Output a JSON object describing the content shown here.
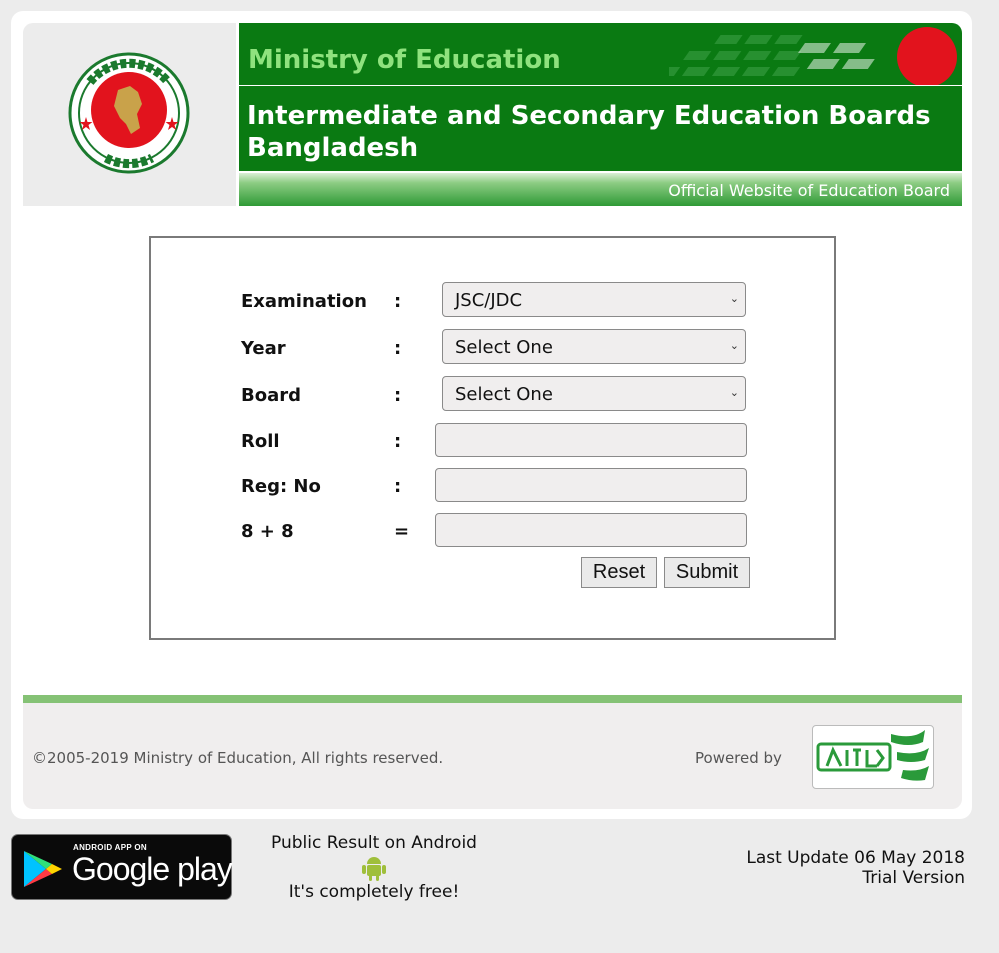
{
  "header": {
    "ministry": "Ministry of Education",
    "board_title_line1": "Intermediate and Secondary Education Boards",
    "board_title_line2": "Bangladesh",
    "official": "Official Website of Education Board",
    "logo_icon": "government-seal-icon"
  },
  "form": {
    "examination": {
      "label": "Examination",
      "separator": ":",
      "value": "JSC/JDC"
    },
    "year": {
      "label": "Year",
      "separator": ":",
      "value": "Select One"
    },
    "board": {
      "label": "Board",
      "separator": ":",
      "value": "Select One"
    },
    "roll": {
      "label": "Roll",
      "separator": ":",
      "value": ""
    },
    "reg_no": {
      "label": "Reg: No",
      "separator": ":",
      "value": ""
    },
    "captcha": {
      "label": "8 + 8",
      "separator": "=",
      "value": ""
    },
    "reset_label": "Reset",
    "submit_label": "Submit"
  },
  "footer": {
    "copyright": "©2005-2019 Ministry of Education, All rights reserved.",
    "powered_by": "Powered by",
    "partner_logo": "teletalk-logo"
  },
  "bottom": {
    "google_play_small": "ANDROID APP ON",
    "google_play_big": "Google play",
    "android_line1": "Public Result on Android",
    "android_line2": "It's completely free!",
    "last_update": "Last Update 06 May 2018",
    "version": "Trial Version"
  },
  "colors": {
    "banner_green": "#0a7a12",
    "ministry_text": "#8fe27e",
    "accent_bar": "#85c275",
    "flag_red": "#e2131d"
  }
}
